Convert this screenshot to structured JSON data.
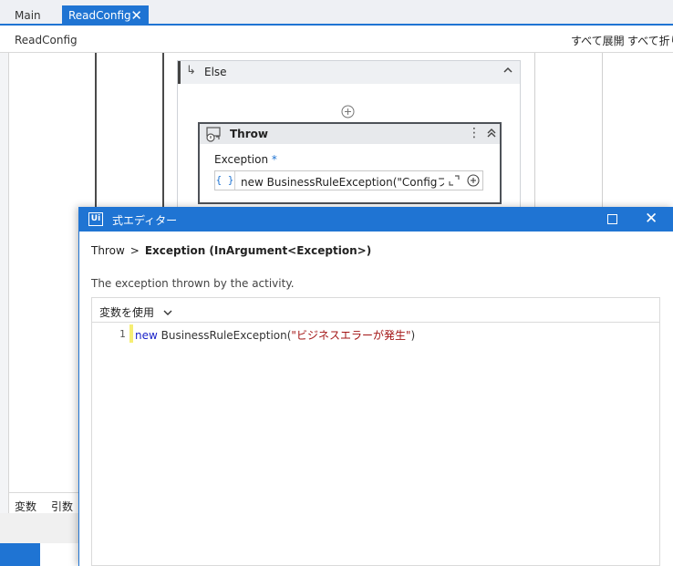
{
  "tabs": [
    {
      "label": "Main",
      "active": false
    },
    {
      "label": "ReadConfig",
      "active": true
    }
  ],
  "designer": {
    "breadcrumb": "ReadConfig",
    "expand_all": "すべて展開",
    "collapse_all": "すべて折り"
  },
  "else_block": {
    "label": "Else"
  },
  "throw_activity": {
    "title": "Throw",
    "property_label": "Exception",
    "required_marker": "*",
    "braces": "{ }",
    "expression_preview": "new BusinessRuleException(\"Configフォルダ"
  },
  "bottom_panel": {
    "variables_tab": "変数",
    "arguments_tab": "引数"
  },
  "expression_editor": {
    "title": "式エディター",
    "breadcrumb_parent": "Throw",
    "breadcrumb_separator": ">",
    "breadcrumb_current": "Exception (InArgument<Exception>)",
    "description": "The exception thrown by the activity.",
    "use_variables": "変数を使用",
    "code": {
      "line_number": "1",
      "keyword": "new",
      "type_name": "BusinessRuleException(",
      "string_literal": "\"ビジネスエラーが発生\"",
      "closing": ")"
    }
  },
  "colors": {
    "accent": "#1f74d3",
    "keyword": "#1a22c9",
    "string": "#a31515",
    "line_marker": "#f6ee74"
  },
  "icons": [
    "close-icon",
    "else-arrow-icon",
    "chevron-up-icon",
    "add-circle-icon",
    "throw-activity-icon",
    "more-vertical-icon",
    "collapse-double-chevron-icon",
    "expand-icon",
    "plus-circle-icon",
    "uipath-logo-icon",
    "maximize-icon",
    "chevron-down-icon"
  ]
}
